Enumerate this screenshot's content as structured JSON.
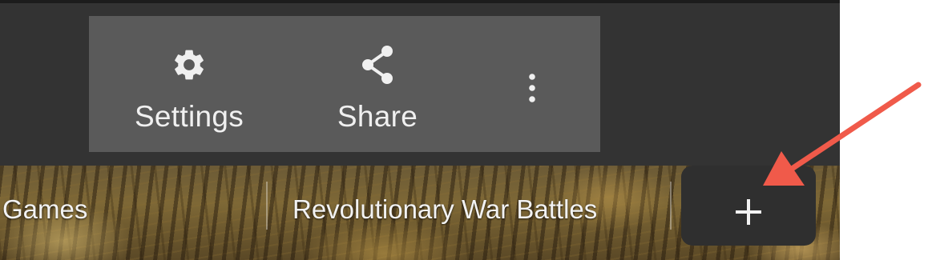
{
  "toolbar": {
    "settings": {
      "label": "Settings",
      "icon": "gear-icon"
    },
    "share": {
      "label": "Share",
      "icon": "share-icon"
    },
    "more": {
      "icon": "more-vertical-icon"
    }
  },
  "tabs": [
    {
      "label": "Games"
    },
    {
      "label": "Revolutionary War Battles"
    }
  ],
  "add_tab": {
    "icon": "plus-icon"
  },
  "colors": {
    "toolbar_bg": "#5a5a5a",
    "frame_bg": "#333333",
    "add_tab_bg": "#2f2f2f",
    "annotation_arrow": "#f05a4a"
  }
}
